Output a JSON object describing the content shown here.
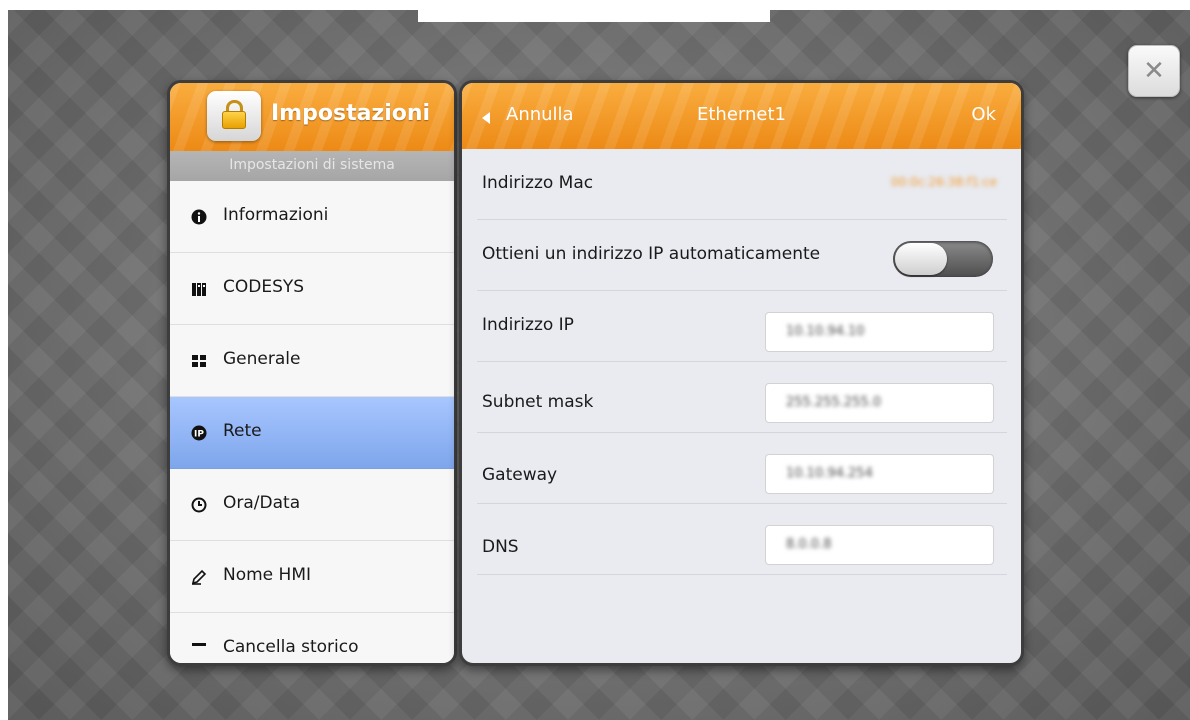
{
  "sidebar": {
    "title": "Impostazioni",
    "subheader": "Impostazioni di sistema",
    "items": [
      {
        "label": "Informazioni",
        "icon": "info-icon"
      },
      {
        "label": "CODESYS",
        "icon": "codesys-icon"
      },
      {
        "label": "Generale",
        "icon": "grid-icon"
      },
      {
        "label": "Rete",
        "icon": "ip-icon",
        "selected": true
      },
      {
        "label": "Ora/Data",
        "icon": "clock-icon"
      },
      {
        "label": "Nome HMI",
        "icon": "pencil-icon"
      },
      {
        "label": "Cancella storico",
        "icon": "trash-icon"
      }
    ]
  },
  "header": {
    "back_label": "Annulla",
    "title": "Ethernet1",
    "ok_label": "Ok"
  },
  "form": {
    "mac_label": "Indirizzo Mac",
    "mac_value": "00:0c:26:38:f1:ce",
    "dhcp_label": "Ottieni un indirizzo IP automaticamente",
    "dhcp_enabled": false,
    "ip_label": "Indirizzo IP",
    "ip_value": "10.10.94.10",
    "subnet_label": "Subnet mask",
    "subnet_value": "255.255.255.0",
    "gateway_label": "Gateway",
    "gateway_value": "10.10.94.254",
    "dns_label": "DNS",
    "dns_value": "8.0.0.8"
  },
  "colors": {
    "accent": "#f39a2e",
    "selected": "#8fb2f3"
  }
}
